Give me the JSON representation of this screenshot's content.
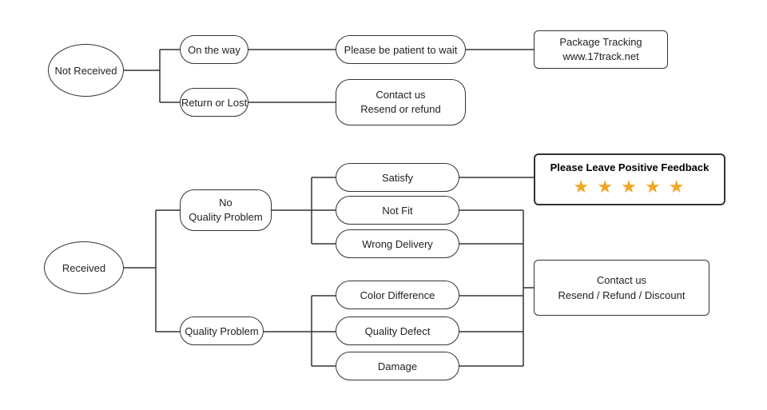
{
  "nodes": {
    "not_received": {
      "label": "Not\nReceived"
    },
    "on_the_way": {
      "label": "On the way"
    },
    "return_or_lost": {
      "label": "Return or Lost"
    },
    "patient": {
      "label": "Please be patient to wait"
    },
    "package_tracking": {
      "label": "Package Tracking\nwww.17track.net"
    },
    "contact_resend": {
      "label": "Contact us\nResend or refund"
    },
    "received": {
      "label": "Received"
    },
    "no_quality_problem": {
      "label": "No\nQuality Problem"
    },
    "quality_problem": {
      "label": "Quality Problem"
    },
    "satisfy": {
      "label": "Satisfy"
    },
    "not_fit": {
      "label": "Not Fit"
    },
    "wrong_delivery": {
      "label": "Wrong Delivery"
    },
    "color_difference": {
      "label": "Color Difference"
    },
    "quality_defect": {
      "label": "Quality Defect"
    },
    "damage": {
      "label": "Damage"
    },
    "please_leave_feedback": {
      "label": "Please Leave Positive Feedback"
    },
    "contact_refund": {
      "label": "Contact us\nResend / Refund / Discount"
    },
    "stars": {
      "label": "★ ★ ★ ★ ★"
    }
  }
}
